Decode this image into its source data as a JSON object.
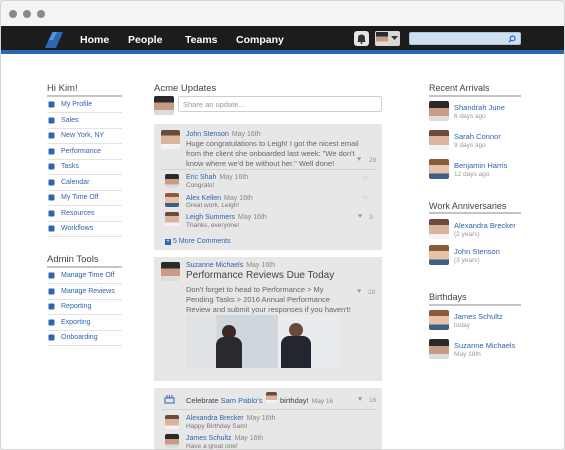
{
  "nav": {
    "links": [
      "Home",
      "People",
      "Teams",
      "Company"
    ],
    "search_placeholder": ""
  },
  "left": {
    "greeting": "Hi Kim!",
    "menu": [
      {
        "label": "My Profile",
        "icon": "person-icon"
      },
      {
        "label": "Sales",
        "icon": "org-chart-icon"
      },
      {
        "label": "New York, NY",
        "icon": "building-icon"
      },
      {
        "label": "Performance",
        "icon": "chart-icon"
      },
      {
        "label": "Tasks",
        "icon": "tasks-icon"
      },
      {
        "label": "Calendar",
        "icon": "calendar-icon"
      },
      {
        "label": "My Time Off",
        "icon": "plane-icon"
      },
      {
        "label": "Resources",
        "icon": "book-icon"
      },
      {
        "label": "Workflows",
        "icon": "check-icon"
      }
    ],
    "admin_title": "Admin Tools",
    "admin_menu": [
      {
        "label": "Manage Time Off",
        "icon": "clock-icon"
      },
      {
        "label": "Manage Reviews",
        "icon": "review-icon"
      },
      {
        "label": "Reporting",
        "icon": "report-icon"
      },
      {
        "label": "Exporting",
        "icon": "export-icon"
      },
      {
        "label": "Onboarding",
        "icon": "add-person-icon"
      }
    ]
  },
  "feed": {
    "title": "Acme Updates",
    "share_placeholder": "Share an update...",
    "post1": {
      "author": "John Stenson",
      "date": "May 16th",
      "text": "Huge congratulations to Leigh! I got the nicest email from the client she onboarded last week: \"We don't know where we'd be without her.\" Well done!",
      "likes": "28",
      "comments": [
        {
          "author": "Eric Shah",
          "date": "May 16th",
          "text": "Congrats!",
          "likes": ""
        },
        {
          "author": "Alex Kellen",
          "date": "May 16th",
          "text": "Great work, Leigh!",
          "likes": ""
        },
        {
          "author": "Leigh Summers",
          "date": "May 16th",
          "text": "Thanks, everyone!",
          "likes": "3"
        }
      ],
      "more_comments": "5 More Comments"
    },
    "post2": {
      "author": "Suzanne Michaels",
      "date": "May 16th",
      "title": "Performance Reviews Due Today",
      "text": "Don't forget to head to Performance > My Pending Tasks > 2016 Annual Performance Review and submit your responses if you haven't!",
      "likes": "28"
    },
    "post3": {
      "prefix": "Celebrate",
      "name": "Sam Pablo's",
      "suffix": "birthday!",
      "date": "May 16",
      "likes": "16",
      "comments": [
        {
          "author": "Alexandra Brecker",
          "date": "May 16th",
          "text": "Happy Birthday Sam!"
        },
        {
          "author": "James Schultz",
          "date": "May 16th",
          "text": "Have a great one!"
        }
      ]
    }
  },
  "right": {
    "arrivals_title": "Recent Arrivals",
    "arrivals": [
      {
        "name": "Shandrah June",
        "sub": "6 days ago"
      },
      {
        "name": "Sarah Connor",
        "sub": "9 days ago"
      },
      {
        "name": "Benjamin Harris",
        "sub": "12 days ago"
      }
    ],
    "anniv_title": "Work Anniversaries",
    "anniversaries": [
      {
        "name": "Alexandra Brecker",
        "sub": "(2 years)"
      },
      {
        "name": "John Stenson",
        "sub": "(3 years)"
      }
    ],
    "bday_title": "Birthdays",
    "birthdays": [
      {
        "name": "James Schultz",
        "sub": "today"
      },
      {
        "name": "Suzanne Michaels",
        "sub": "May 18th"
      }
    ]
  },
  "colors": {
    "nav_bg": "#1c1c1c",
    "accent": "#2b67b3",
    "link": "#2f64b0"
  }
}
